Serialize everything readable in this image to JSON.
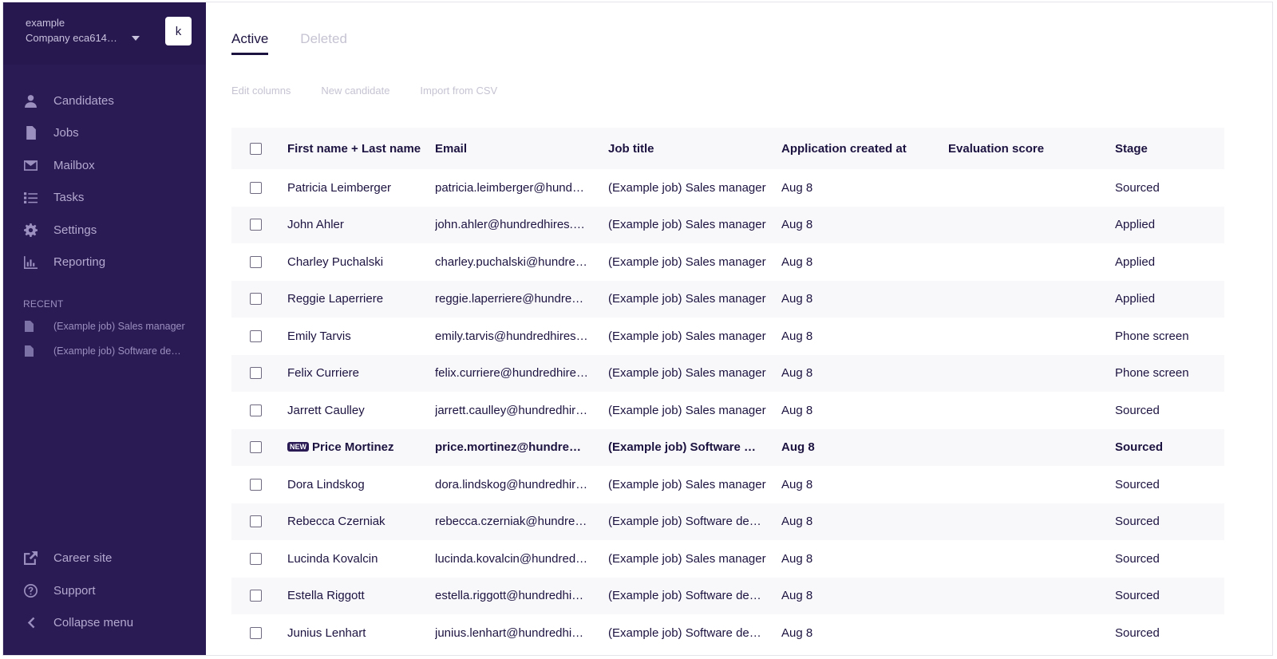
{
  "org": {
    "line1": "example",
    "company": "Company eca614…",
    "avatar": "k"
  },
  "nav": [
    {
      "label": "Candidates",
      "icon": "user-icon"
    },
    {
      "label": "Jobs",
      "icon": "document-icon"
    },
    {
      "label": "Mailbox",
      "icon": "envelope-icon"
    },
    {
      "label": "Tasks",
      "icon": "checklist-icon"
    },
    {
      "label": "Settings",
      "icon": "gear-icon"
    },
    {
      "label": "Reporting",
      "icon": "bar-chart-icon"
    }
  ],
  "recent": {
    "title": "RECENT",
    "items": [
      {
        "label": "(Example job) Sales manager"
      },
      {
        "label": "(Example job) Software de…"
      }
    ]
  },
  "bottom_nav": [
    {
      "label": "Career site",
      "icon": "external-link-icon"
    },
    {
      "label": "Support",
      "icon": "help-circle-icon"
    },
    {
      "label": "Collapse menu",
      "icon": "chevron-left-icon"
    }
  ],
  "tabs": [
    {
      "label": "Active"
    },
    {
      "label": "Deleted"
    }
  ],
  "toolbar": {
    "edit_columns": "Edit columns",
    "new_candidate": "New candidate",
    "import_csv": "Import from CSV"
  },
  "table": {
    "headers": {
      "name": "First name + Last name",
      "email": "Email",
      "job": "Job title",
      "date": "Application created at",
      "score": "Evaluation score",
      "stage": "Stage"
    },
    "new_badge": "NEW",
    "rows": [
      {
        "name": "Patricia Leimberger",
        "email": "patricia.leimberger@hund…",
        "job": "(Example job) Sales manager",
        "date": "Aug 8",
        "score": "",
        "stage": "Sourced"
      },
      {
        "name": "John Ahler",
        "email": "john.ahler@hundredhires.…",
        "job": "(Example job) Sales manager",
        "date": "Aug 8",
        "score": "",
        "stage": "Applied"
      },
      {
        "name": "Charley Puchalski",
        "email": "charley.puchalski@hundre…",
        "job": "(Example job) Sales manager",
        "date": "Aug 8",
        "score": "",
        "stage": "Applied"
      },
      {
        "name": "Reggie Laperriere",
        "email": "reggie.laperriere@hundre…",
        "job": "(Example job) Sales manager",
        "date": "Aug 8",
        "score": "",
        "stage": "Applied"
      },
      {
        "name": "Emily Tarvis",
        "email": "emily.tarvis@hundredhires…",
        "job": "(Example job) Sales manager",
        "date": "Aug 8",
        "score": "",
        "stage": "Phone screen"
      },
      {
        "name": "Felix Curriere",
        "email": "felix.curriere@hundredhire…",
        "job": "(Example job) Sales manager",
        "date": "Aug 8",
        "score": "",
        "stage": "Phone screen"
      },
      {
        "name": "Jarrett Caulley",
        "email": "jarrett.caulley@hundredhir…",
        "job": "(Example job) Sales manager",
        "date": "Aug 8",
        "score": "",
        "stage": "Sourced"
      },
      {
        "name": "Price Mortinez",
        "email": "price.mortinez@hundre…",
        "job": "(Example job) Software …",
        "date": "Aug 8",
        "score": "",
        "stage": "Sourced",
        "is_new": true
      },
      {
        "name": "Dora Lindskog",
        "email": "dora.lindskog@hundredhir…",
        "job": "(Example job) Sales manager",
        "date": "Aug 8",
        "score": "",
        "stage": "Sourced"
      },
      {
        "name": "Rebecca Czerniak",
        "email": "rebecca.czerniak@hundre…",
        "job": "(Example job) Software de…",
        "date": "Aug 8",
        "score": "",
        "stage": "Sourced"
      },
      {
        "name": "Lucinda Kovalcin",
        "email": "lucinda.kovalcin@hundred…",
        "job": "(Example job) Sales manager",
        "date": "Aug 8",
        "score": "",
        "stage": "Sourced"
      },
      {
        "name": "Estella Riggott",
        "email": "estella.riggott@hundredhi…",
        "job": "(Example job) Software de…",
        "date": "Aug 8",
        "score": "",
        "stage": "Sourced"
      },
      {
        "name": "Junius Lenhart",
        "email": "junius.lenhart@hundredhi…",
        "job": "(Example job) Software de…",
        "date": "Aug 8",
        "score": "",
        "stage": "Sourced"
      }
    ]
  }
}
